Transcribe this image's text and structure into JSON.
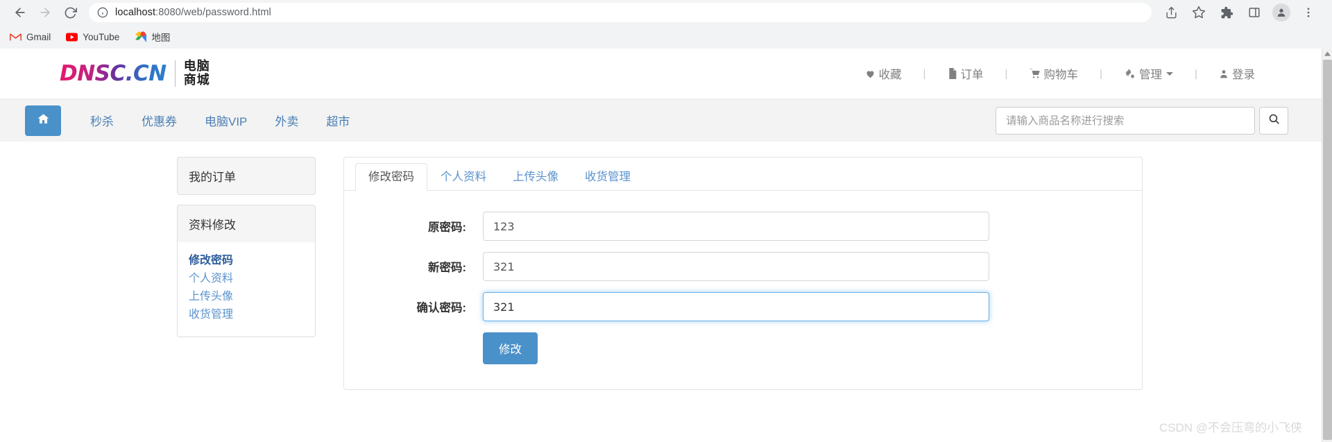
{
  "browser": {
    "back_label": "Back",
    "forward_label": "Forward",
    "reload_label": "Reload",
    "url_host": "localhost",
    "url_path": ":8080/web/password.html",
    "site_info_icon": "info-circle-icon",
    "actions": [
      {
        "name": "share-icon",
        "label": "Share"
      },
      {
        "name": "bookmark-star-icon",
        "label": "Bookmark this tab"
      },
      {
        "name": "extensions-puzzle-icon",
        "label": "Extensions"
      },
      {
        "name": "side-panel-icon",
        "label": "Side panel"
      },
      {
        "name": "profile-avatar-icon",
        "label": "Profile"
      },
      {
        "name": "more-menu-icon",
        "label": "Customize and control"
      }
    ],
    "bookmarks": [
      {
        "label": "Gmail",
        "icon": "gmail-icon"
      },
      {
        "label": "YouTube",
        "icon": "youtube-icon"
      },
      {
        "label": "地图",
        "icon": "google-maps-icon"
      }
    ]
  },
  "site": {
    "logo_text": "DNSC.CN",
    "logo_cn_line1": "电脑",
    "logo_cn_line2": "商城",
    "top_nav": [
      {
        "label": "收藏",
        "icon": "heart-icon"
      },
      {
        "label": "订单",
        "icon": "file-icon"
      },
      {
        "label": "购物车",
        "icon": "cart-icon"
      },
      {
        "label": "管理",
        "icon": "gears-icon",
        "has_caret": true
      },
      {
        "label": "登录",
        "icon": "user-icon"
      }
    ],
    "separator": "|",
    "home_icon": "home-icon",
    "nav_links": [
      {
        "label": "秒杀"
      },
      {
        "label": "优惠券"
      },
      {
        "label": "电脑VIP"
      },
      {
        "label": "外卖"
      },
      {
        "label": "超市"
      }
    ],
    "search": {
      "placeholder": "请输入商品名称进行搜索",
      "value": "",
      "button_icon": "search-icon"
    }
  },
  "sidebar": {
    "orders_panel": {
      "title": "我的订单"
    },
    "profile_panel": {
      "title": "资料修改",
      "links": [
        {
          "label": "修改密码",
          "active": true
        },
        {
          "label": "个人资料",
          "active": false
        },
        {
          "label": "上传头像",
          "active": false
        },
        {
          "label": "收货管理",
          "active": false
        }
      ]
    }
  },
  "main": {
    "tabs": [
      {
        "label": "修改密码",
        "active": true
      },
      {
        "label": "个人资料",
        "active": false
      },
      {
        "label": "上传头像",
        "active": false
      },
      {
        "label": "收货管理",
        "active": false
      }
    ],
    "form": {
      "fields": [
        {
          "label": "原密码:",
          "value": "123",
          "focused": false
        },
        {
          "label": "新密码:",
          "value": "321",
          "focused": false
        },
        {
          "label": "确认密码:",
          "value": "321",
          "focused": true
        }
      ],
      "submit_label": "修改"
    }
  },
  "watermark": "CSDN @不会压弯的小飞侠",
  "colors": {
    "accent_blue": "#4a90c9",
    "link_blue": "#5b93cc",
    "active_link": "#2c5d9b",
    "focus_blue": "#66afe9",
    "chrome_bg": "#f1f3f4",
    "navbar_bg": "#f3f3f3"
  }
}
